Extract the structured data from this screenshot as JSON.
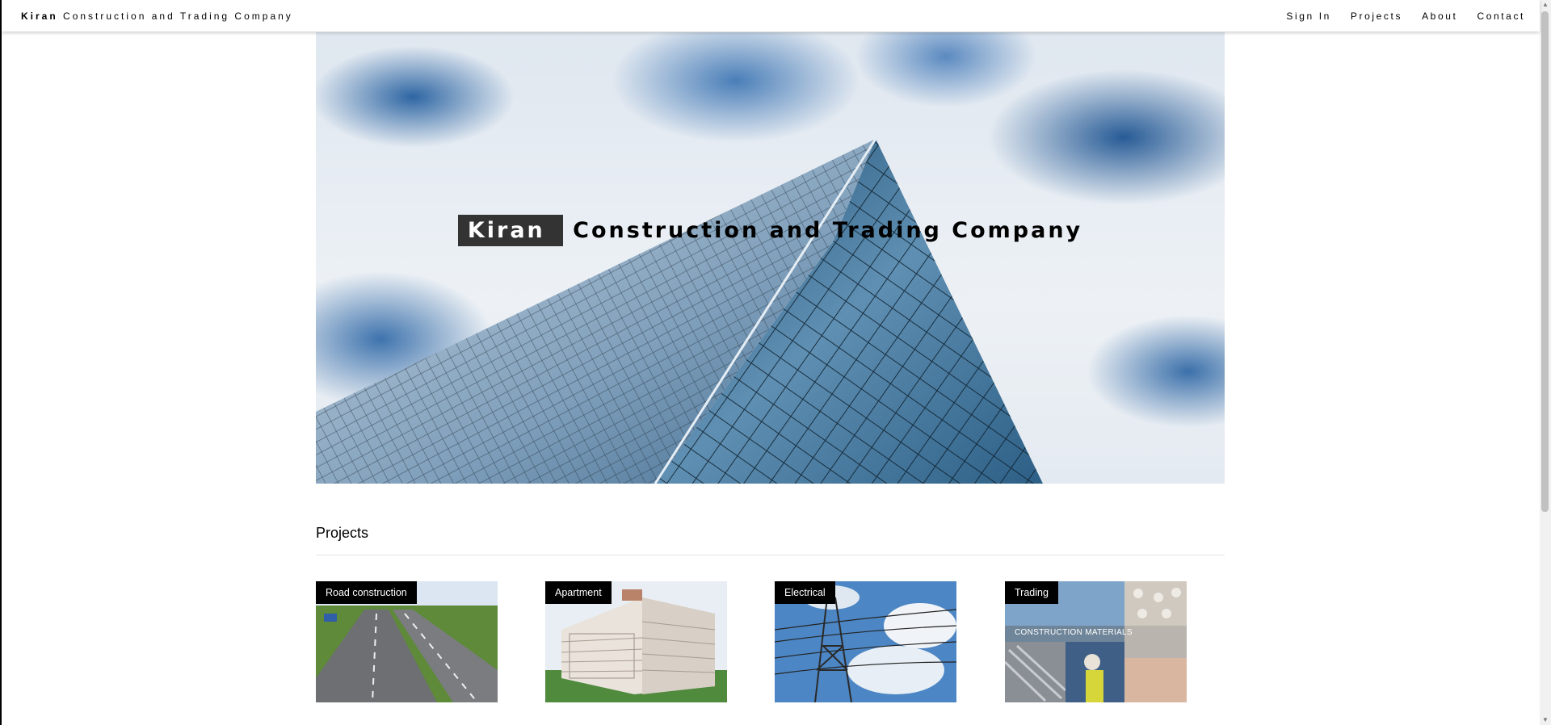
{
  "header": {
    "brand_bold": "Kiran",
    "brand_rest": " Construction and Trading Company",
    "nav": [
      "Sign In",
      "Projects",
      "About",
      "Contact"
    ]
  },
  "hero": {
    "title_highlight": "Kiran",
    "title_rest": " Construction and Trading Company"
  },
  "projects": {
    "heading": "Projects",
    "cards": [
      {
        "label": "Road construction"
      },
      {
        "label": "Apartment"
      },
      {
        "label": "Electrical"
      },
      {
        "label": "Trading",
        "image_text": "CONSTRUCTION MATERIALS"
      }
    ]
  },
  "colors": {
    "tag_bg": "#000000",
    "hero_highlight_bg": "#333333",
    "divider": "#e3e3e3"
  }
}
